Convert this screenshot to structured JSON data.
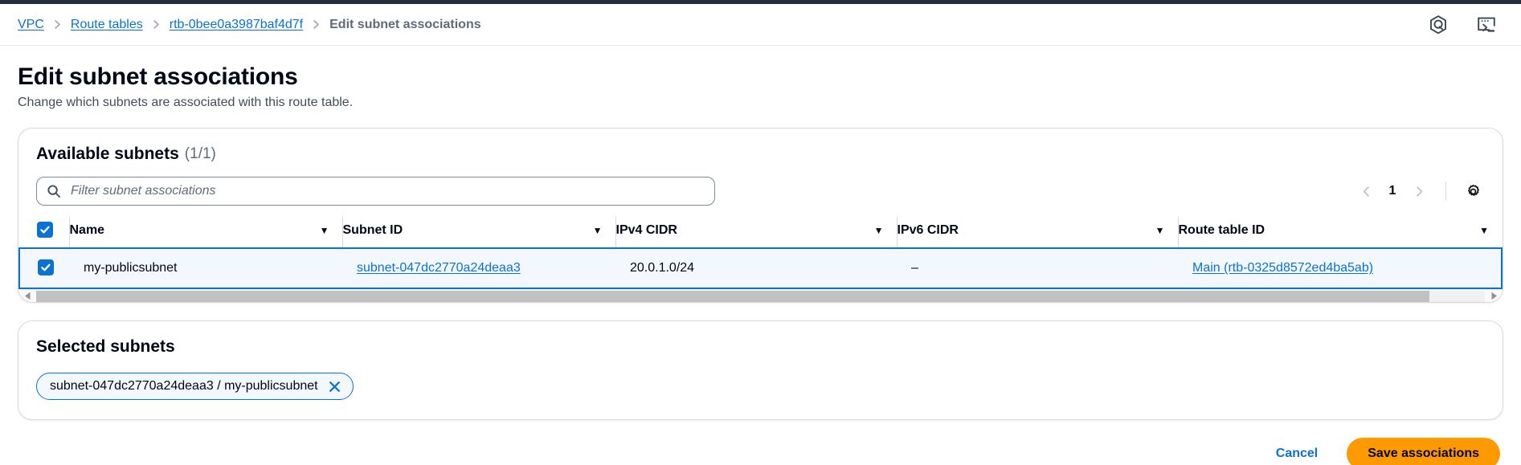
{
  "breadcrumb": {
    "items": [
      {
        "label": "VPC",
        "type": "link"
      },
      {
        "label": "Route tables",
        "type": "link"
      },
      {
        "label": "rtb-0bee0a3987baf4d7f",
        "type": "link"
      },
      {
        "label": "Edit subnet associations",
        "type": "current"
      }
    ]
  },
  "top_icons": [
    {
      "name": "amazon-q-icon",
      "label": "Amazon Q"
    },
    {
      "name": "cloudshell-icon",
      "label": "CloudShell"
    }
  ],
  "header": {
    "title": "Edit subnet associations",
    "description": "Change which subnets are associated with this route table."
  },
  "available_subnets": {
    "title": "Available subnets",
    "count": "(1/1)",
    "search": {
      "placeholder": "Filter subnet associations",
      "value": "",
      "icon": "search-icon"
    },
    "pagination": {
      "prev_icon": "chevron-left-icon",
      "page": "1",
      "next_icon": "chevron-right-icon",
      "settings_icon": "gear-icon"
    },
    "columns": [
      {
        "label": "Name",
        "sort_icon": "filter-caret-icon"
      },
      {
        "label": "Subnet ID",
        "sort_icon": "filter-caret-icon"
      },
      {
        "label": "IPv4 CIDR",
        "sort_icon": "filter-caret-icon"
      },
      {
        "label": "IPv6 CIDR",
        "sort_icon": "filter-caret-icon"
      },
      {
        "label": "Route table ID",
        "sort_icon": "filter-caret-icon"
      }
    ],
    "header_checkbox_checked": true,
    "rows": [
      {
        "checked": true,
        "name": "my-publicsubnet",
        "subnet_id": "subnet-047dc2770a24deaa3",
        "ipv4_cidr": "20.0.1.0/24",
        "ipv6_cidr": "–",
        "route_table_id": "Main (rtb-0325d8572ed4ba5ab)"
      }
    ],
    "scrollbar": {
      "left_icon": "scroll-left-arrow-icon",
      "right_icon": "scroll-right-arrow-icon"
    }
  },
  "selected_subnets": {
    "title": "Selected subnets",
    "chips": [
      {
        "label": "subnet-047dc2770a24deaa3 / my-publicsubnet",
        "remove_icon": "close-icon"
      }
    ]
  },
  "footer": {
    "cancel_label": "Cancel",
    "save_label": "Save associations"
  },
  "colors": {
    "link": "#0972d3",
    "primary_button": "#ff9900",
    "selected_row_bg": "#f2f8fd",
    "selected_row_border": "#0972d3",
    "top_strip": "#232f3e"
  }
}
